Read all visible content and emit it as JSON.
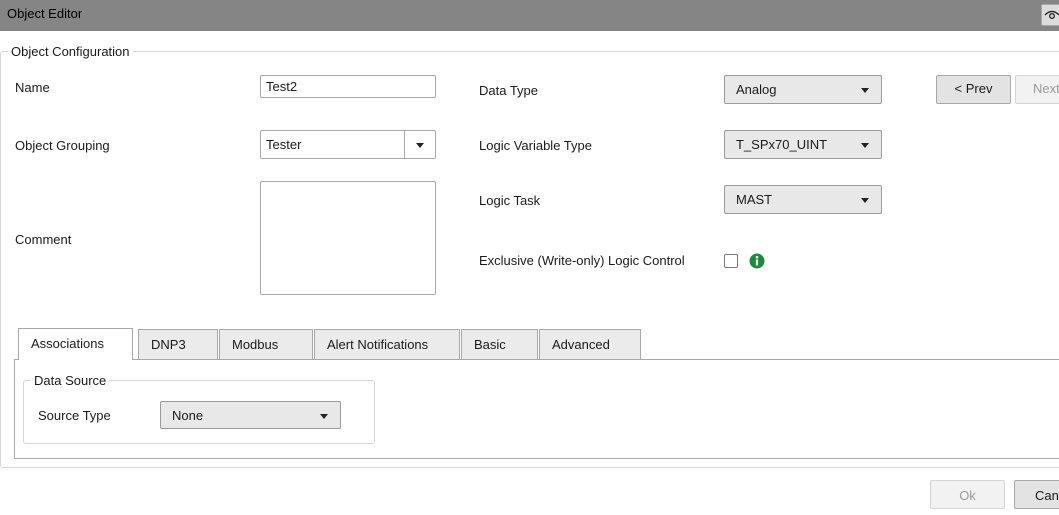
{
  "window": {
    "title": "Object Editor"
  },
  "config": {
    "legend": "Object Configuration",
    "name_label": "Name",
    "name_value": "Test2",
    "grouping_label": "Object Grouping",
    "grouping_value": "Tester",
    "comment_label": "Comment",
    "comment_value": "",
    "data_type_label": "Data Type",
    "data_type_value": "Analog",
    "logic_var_label": "Logic Variable Type",
    "logic_var_value": "T_SPx70_UINT",
    "logic_task_label": "Logic Task",
    "logic_task_value": "MAST",
    "exclusive_label": "Exclusive (Write-only) Logic Control",
    "exclusive_checked": false
  },
  "nav": {
    "prev_label": "< Prev",
    "next_label": "Next"
  },
  "tabs": [
    {
      "label": "Associations",
      "active": true
    },
    {
      "label": "DNP3"
    },
    {
      "label": "Modbus"
    },
    {
      "label": "Alert Notifications"
    },
    {
      "label": "Basic"
    },
    {
      "label": "Advanced"
    }
  ],
  "associations": {
    "legend": "Data Source",
    "source_type_label": "Source Type",
    "source_type_value": "None"
  },
  "footer": {
    "ok_label": "Ok",
    "cancel_label": "Cancel"
  },
  "colors": {
    "info_icon": "#1b8a3a",
    "titlebar": "#858585"
  },
  "icons": {
    "titlebar_button": "eye-icon",
    "dropdown": "chevron-down-icon",
    "info": "info-icon"
  }
}
